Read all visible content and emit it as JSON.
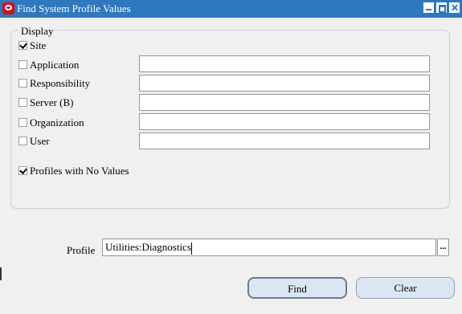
{
  "window": {
    "title": "Find System Profile Values",
    "logo_icon": "oracle-logo-icon",
    "controls": [
      "minimize-icon",
      "maximize-icon",
      "close-icon"
    ],
    "titlebar_color": "#2f78bd"
  },
  "display": {
    "group_label": "Display",
    "site": {
      "label": "Site",
      "checked": true
    },
    "rows": [
      {
        "label": "Application",
        "checked": false,
        "value": ""
      },
      {
        "label": "Responsibility",
        "checked": false,
        "value": ""
      },
      {
        "label": "Server (B)",
        "checked": false,
        "value": ""
      },
      {
        "label": "Organization",
        "checked": false,
        "value": ""
      },
      {
        "label": "User",
        "checked": false,
        "value": ""
      }
    ],
    "no_values": {
      "label": "Profiles with No Values",
      "checked": true
    }
  },
  "profile": {
    "label": "Profile",
    "value": "Utilities:Diagnostics",
    "lov_label": "..."
  },
  "buttons": {
    "find": "Find",
    "clear": "Clear"
  }
}
